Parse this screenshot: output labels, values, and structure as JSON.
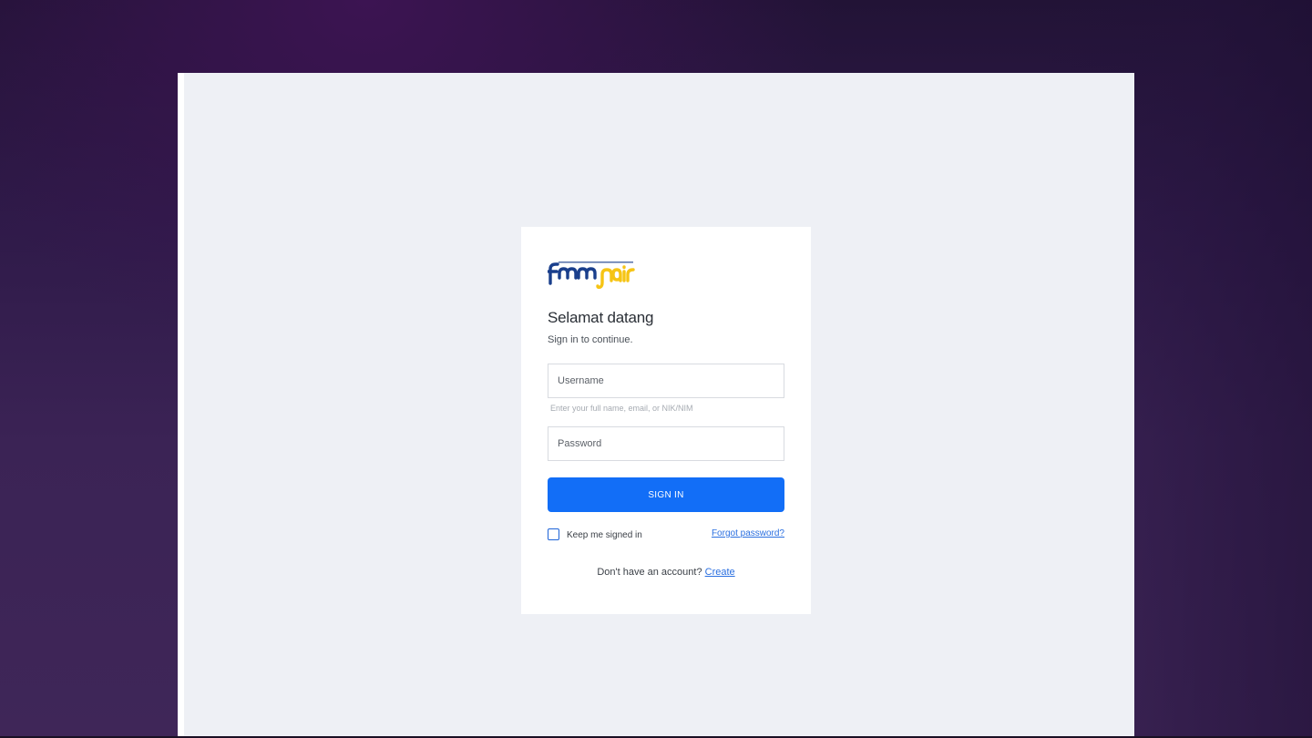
{
  "login": {
    "logo_name": "fmm-nair-logo",
    "title": "Selamat datang",
    "subtitle": "Sign in to continue.",
    "username": {
      "placeholder": "Username",
      "value": "",
      "hint": "Enter your full name, email, or NIK/NIM"
    },
    "password": {
      "placeholder": "Password",
      "value": ""
    },
    "signin_label": "SIGN IN",
    "remember_label": "Keep me signed in",
    "remember_checked": false,
    "forgot_label": "Forgot password?",
    "signup_prompt": "Don't have an account?",
    "signup_link": "Create"
  },
  "colors": {
    "accent": "#126ef7",
    "link": "#2a6fe0",
    "logo_blue": "#1a3f8c",
    "logo_yellow": "#f6c414"
  }
}
